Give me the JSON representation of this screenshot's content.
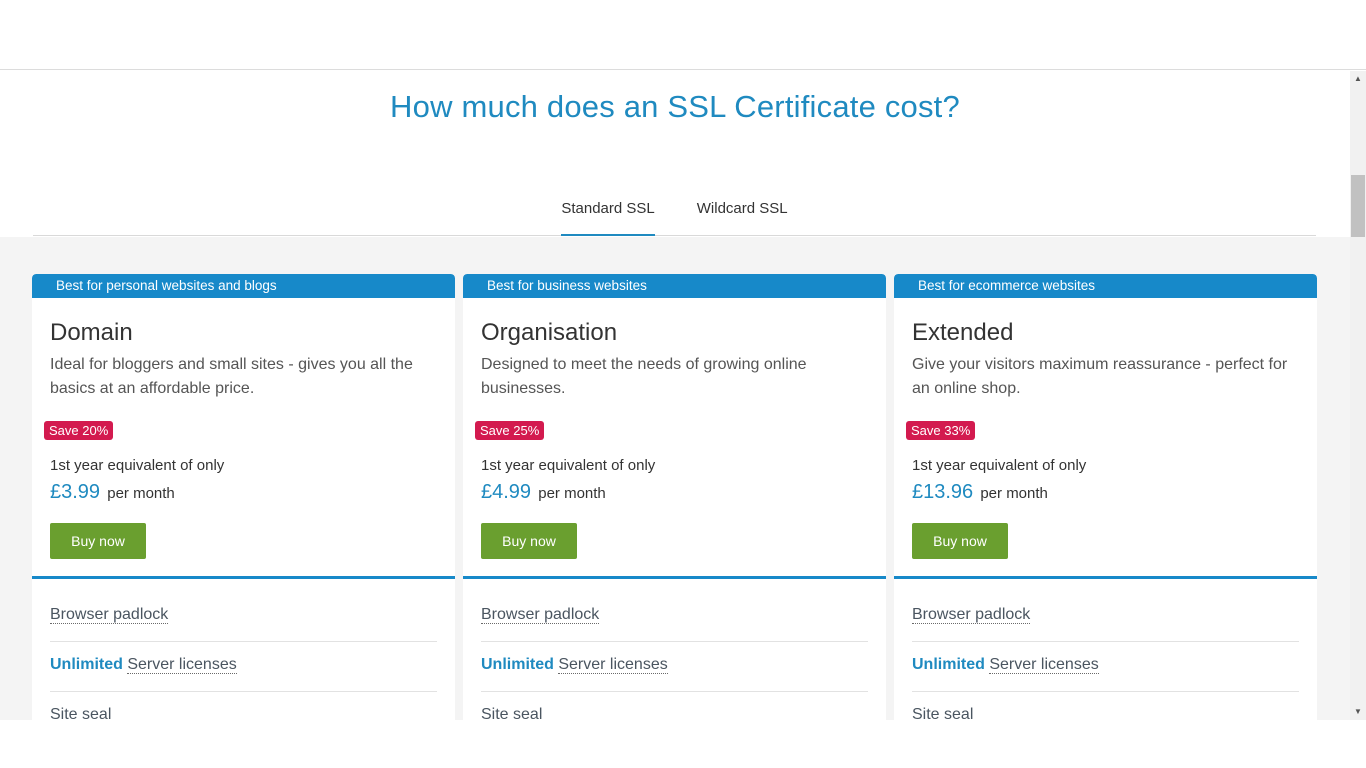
{
  "page": {
    "heading": "How much does an SSL Certificate cost?"
  },
  "tabs": [
    {
      "label": "Standard SSL",
      "active": true
    },
    {
      "label": "Wildcard SSL",
      "active": false
    }
  ],
  "cards": [
    {
      "banner": "Best for personal websites and blogs",
      "title": "Domain",
      "description": "Ideal for bloggers and small sites - gives you all the basics at an affordable price.",
      "save": "Save 20%",
      "equivalent": "1st year equivalent of only",
      "price": "£3.99",
      "period": "per month",
      "button": "Buy now",
      "features": {
        "padlock": "Browser padlock",
        "unlimited": "Unlimited",
        "server_licenses": "Server licenses",
        "site_seal": "Site seal"
      }
    },
    {
      "banner": "Best for business websites",
      "title": "Organisation",
      "description": "Designed to meet the needs of growing online businesses.",
      "save": "Save 25%",
      "equivalent": "1st year equivalent of only",
      "price": "£4.99",
      "period": "per month",
      "button": "Buy now",
      "features": {
        "padlock": "Browser padlock",
        "unlimited": "Unlimited",
        "server_licenses": "Server licenses",
        "site_seal": "Site seal"
      }
    },
    {
      "banner": "Best for ecommerce websites",
      "title": "Extended",
      "description": "Give your visitors maximum reassurance - perfect for an online shop.",
      "save": "Save 33%",
      "equivalent": "1st year equivalent of only",
      "price": "£13.96",
      "period": "per month",
      "button": "Buy now",
      "features": {
        "padlock": "Browser padlock",
        "unlimited": "Unlimited",
        "server_licenses": "Server licenses",
        "site_seal": "Site seal"
      }
    }
  ],
  "scrollbar": {
    "up_icon": "triangle-up",
    "down_icon": "triangle-down"
  },
  "colors": {
    "accent": "#1f8ac0",
    "banner": "#1789c9",
    "save_badge": "#d31a4f",
    "buy_button": "#6a9f2f"
  }
}
